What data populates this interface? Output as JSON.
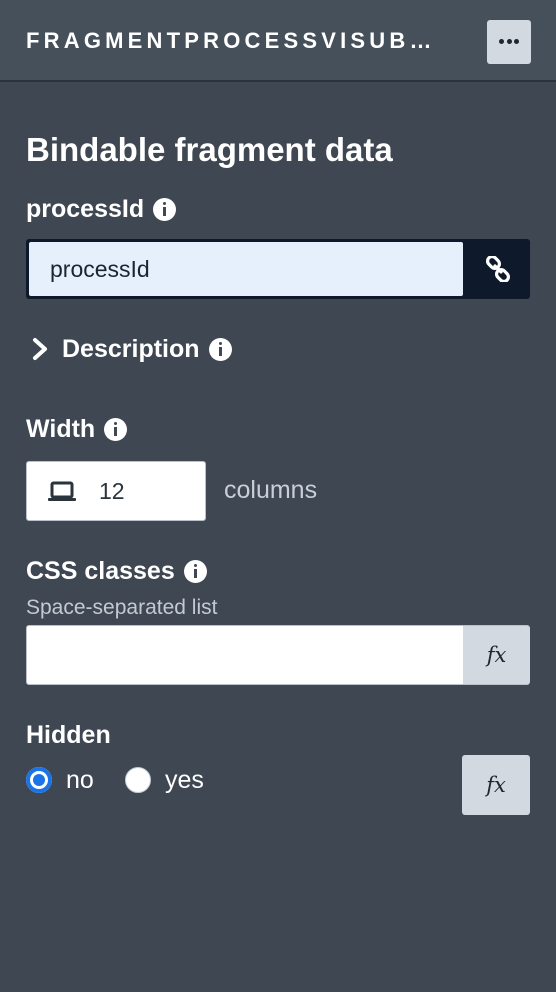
{
  "header": {
    "title": "FRAGMENTPROCESSVISUB…",
    "menu_icon": "more-horizontal-icon"
  },
  "section": {
    "title": "Bindable fragment data"
  },
  "process_id": {
    "label": "processId",
    "value": "processId",
    "bind_icon": "link-icon"
  },
  "description": {
    "label": "Description",
    "expanded": false
  },
  "width": {
    "label": "Width",
    "device_icon": "laptop-icon",
    "value": "12",
    "unit": "columns"
  },
  "css_classes": {
    "label": "CSS classes",
    "hint": "Space-separated list",
    "value": "",
    "fx_label": "fx"
  },
  "hidden": {
    "label": "Hidden",
    "options": [
      {
        "label": "no",
        "checked": true
      },
      {
        "label": "yes",
        "checked": false
      }
    ],
    "fx_label": "fx"
  },
  "colors": {
    "background": "#3f4752",
    "header": "#46505b",
    "accent": "#1a74e8",
    "bound_field_bg": "#e6effc",
    "button_bg": "#d2d9e1"
  }
}
